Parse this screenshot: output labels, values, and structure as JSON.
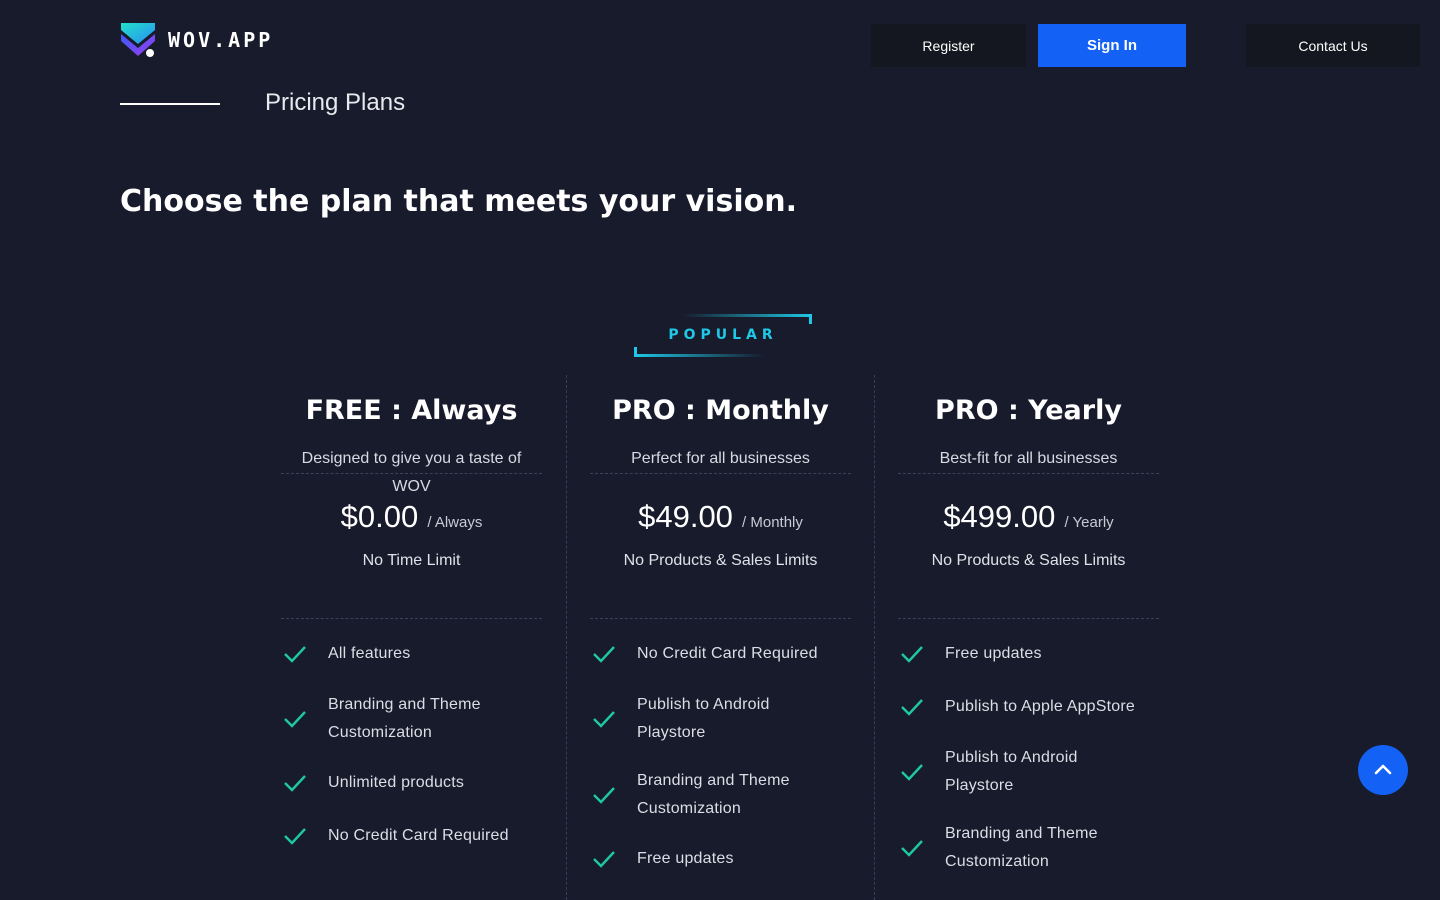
{
  "colors": {
    "background": "#181b2c",
    "accent": "#1462f5",
    "check": "#1fc9a0",
    "popular": "#1ec8e6"
  },
  "header": {
    "logo_text": "WOV.APP",
    "register_label": "Register",
    "signin_label": "Sign In",
    "contact_label": "Contact Us"
  },
  "section": {
    "label": "Pricing Plans",
    "headline": "Choose the plan that meets your vision."
  },
  "popular_badge": "POPULAR",
  "plans": [
    {
      "title": "FREE : Always",
      "description": "Designed to give you a taste of WOV",
      "price": "$0.00",
      "period": "/ Always",
      "limit": "No Time Limit",
      "features": [
        "All features",
        "Branding and Theme Customization",
        "Unlimited products",
        "No Credit Card Required"
      ]
    },
    {
      "title": "PRO : Monthly",
      "description": "Perfect for all businesses",
      "price": "$49.00",
      "period": "/ Monthly",
      "limit": "No Products & Sales Limits",
      "features": [
        "No Credit Card Required",
        "Publish to Android Playstore",
        "Branding and Theme Customization",
        "Free updates"
      ]
    },
    {
      "title": "PRO : Yearly",
      "description": "Best-fit for all businesses",
      "price": "$499.00",
      "period": "/ Yearly",
      "limit": "No Products & Sales Limits",
      "features": [
        "Free updates",
        "Publish to Apple AppStore",
        "Publish to Android Playstore",
        "Branding and Theme Customization"
      ]
    }
  ],
  "icons": {
    "check": "check-icon",
    "scroll_top": "chevron-up-icon",
    "logo": "wov-logo-icon"
  }
}
